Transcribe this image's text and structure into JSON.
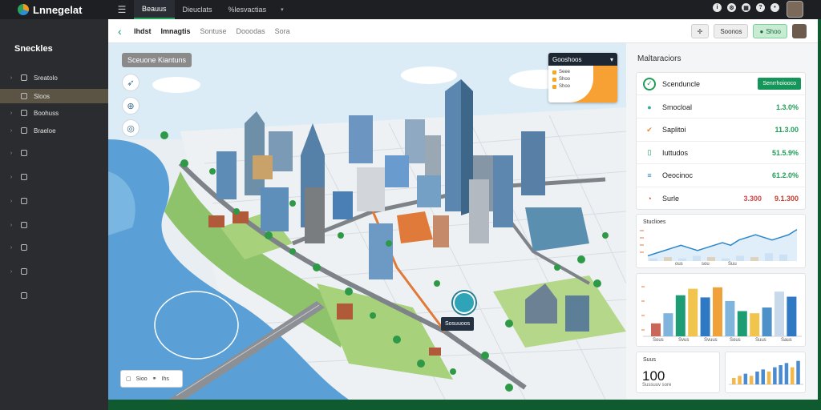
{
  "app": {
    "name": "Lnnegelat"
  },
  "topbar": {
    "tabs": [
      "Beauus",
      "Dieuclats",
      "%lesvactias"
    ],
    "icons": [
      "info-icon",
      "settings-icon",
      "grid-icon",
      "help-icon",
      "bell-icon"
    ]
  },
  "sidebar": {
    "title": "Sneckles",
    "items": [
      {
        "label": "Sreatolo",
        "icon": "layers-icon",
        "active": false,
        "chevron": true
      },
      {
        "label": "Sloos",
        "icon": "map-icon",
        "active": true,
        "chevron": false
      },
      {
        "label": "Boohuss",
        "icon": "building-icon",
        "active": false,
        "chevron": true
      },
      {
        "label": "Braeloe",
        "icon": "chart-icon",
        "active": false,
        "chevron": true
      },
      {
        "label": "",
        "icon": "clock-icon",
        "active": false,
        "chevron": true
      },
      {
        "label": "",
        "icon": "doc-icon",
        "active": false,
        "chevron": true
      },
      {
        "label": "",
        "icon": "pin-icon",
        "active": false,
        "chevron": true
      },
      {
        "label": "",
        "icon": "mail-icon",
        "active": false,
        "chevron": true
      },
      {
        "label": "",
        "icon": "calendar-icon",
        "active": false,
        "chevron": true
      },
      {
        "label": "",
        "icon": "cloud-icon",
        "active": false,
        "chevron": true
      },
      {
        "label": "",
        "icon": "home-icon",
        "active": false,
        "chevron": false
      }
    ]
  },
  "subbar": {
    "crumbs": [
      "Ihdst",
      "Imnagtis",
      "Sontuse",
      "Dooodas",
      "Sora"
    ],
    "actions": [
      "Soonos",
      "Shoo"
    ]
  },
  "map": {
    "label": "Sceuone Kiantuns",
    "card": {
      "title": "Gooshoos",
      "rows": [
        "Seee",
        "Shoo",
        "Shoo"
      ]
    },
    "pin_label": "Sosuuoos",
    "legend": [
      "Sioo",
      "Ihs"
    ],
    "tools": [
      "compass-icon",
      "globe-icon",
      "camera-icon"
    ]
  },
  "panel": {
    "title": "Maltaraciors",
    "kpi": {
      "header_label": "Scenduncle",
      "header_button": "Senrrhoiooco",
      "rows": [
        {
          "label": "Smocloal",
          "value": "1.3.0%",
          "color": "#1f9d57",
          "icon": "circle-icon"
        },
        {
          "label": "Saplitoi",
          "value": "11.3.00",
          "color": "#1f9d57",
          "icon": "check-icon"
        },
        {
          "label": "Iuttudos",
          "value": "51.5.9%",
          "color": "#1f9d57",
          "icon": "document-icon"
        },
        {
          "label": "Oeocinoc",
          "value": "61.2.0%",
          "color": "#1f9d57",
          "icon": "list-icon"
        },
        {
          "label": "Surle",
          "value": "9.1.300",
          "mid": "3.300",
          "color": "#c0392b",
          "icon": "pie-icon"
        }
      ]
    },
    "line_card": {
      "title": "Stuclioes",
      "labels": [
        "ous",
        "sou",
        "Suu"
      ]
    },
    "bar_card": {
      "labels": [
        "Sous",
        "Svus",
        "Svuus",
        "Sous",
        "Suus",
        "Saus"
      ]
    },
    "stat_card": {
      "title": "Suus",
      "value": "100",
      "sub": "Sussuuv sore"
    }
  },
  "chart_data": [
    {
      "type": "area",
      "title": "Stuclioes",
      "series": [
        {
          "values": [
            2,
            3,
            4,
            5,
            6,
            5,
            4,
            5,
            6,
            7,
            6,
            8,
            9,
            10,
            9,
            8,
            9,
            10,
            12
          ]
        }
      ],
      "bars": [
        1,
        1.5,
        1,
        2,
        1.5,
        1,
        2,
        1.5,
        3,
        2.5
      ],
      "ylim": [
        0,
        14
      ]
    },
    {
      "type": "bar",
      "categories": [
        "Sous",
        "Svus",
        "Svuus",
        "Sous",
        "Suus",
        "Saus"
      ],
      "values": [
        18,
        32,
        57,
        66,
        54,
        68,
        49,
        35,
        32,
        40,
        62,
        55
      ],
      "colors": [
        "#c9675a",
        "#7fb4dc",
        "#1e9c74",
        "#f1c44d",
        "#2f78c4",
        "#f0a13a",
        "#7fb4dc",
        "#1e9c74",
        "#f1c44d",
        "#4c92c8",
        "#c7d9ea",
        "#2f78c4"
      ],
      "ylim": [
        0,
        80
      ]
    },
    {
      "type": "bar",
      "values": [
        3,
        4,
        5,
        4,
        6,
        7,
        6,
        8,
        9,
        10,
        8,
        11
      ],
      "colors": [
        "#f2b84b",
        "#f2b84b",
        "#4a8ad0",
        "#f2b84b",
        "#4a8ad0",
        "#4a8ad0",
        "#f2b84b",
        "#4a8ad0",
        "#4a8ad0",
        "#4a8ad0",
        "#f2b84b",
        "#4a8ad0"
      ],
      "ylim": [
        0,
        12
      ]
    }
  ]
}
